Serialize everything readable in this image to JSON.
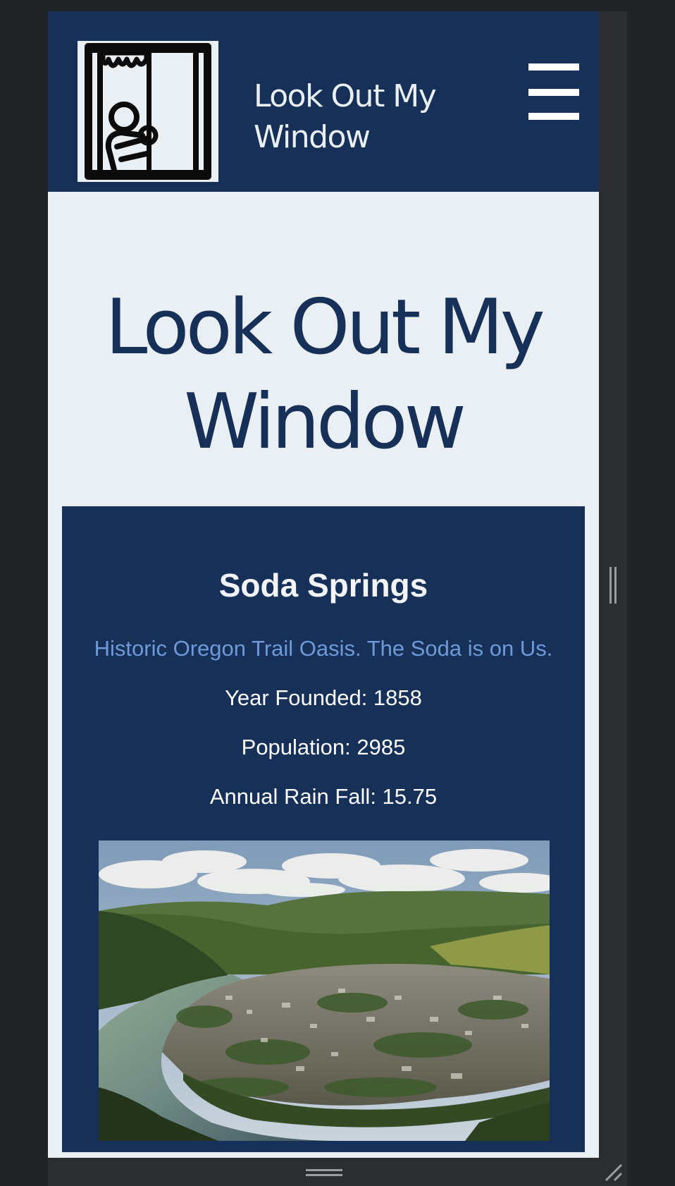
{
  "header": {
    "logo_icon": "person-at-window-icon",
    "brand_line1": "Look Out My",
    "brand_line2": "Window",
    "menu_icon": "hamburger-menu-icon"
  },
  "hero": {
    "title_line1": "Look Out My",
    "title_line2": "Window"
  },
  "city": {
    "name": "Soda Springs",
    "motto": "Historic Oregon Trail Oasis. The Soda is on Us.",
    "year_founded": "Year Founded: 1858",
    "population": "Population: 2985",
    "annual_rainfall": "Annual Rain Fall: 15.75",
    "photo": "river-town-aerial-photo"
  },
  "colors": {
    "navy": "#163058",
    "page_background": "#e9eff3",
    "motto_blue": "#6e9ad9",
    "emulator_background": "#222326"
  }
}
